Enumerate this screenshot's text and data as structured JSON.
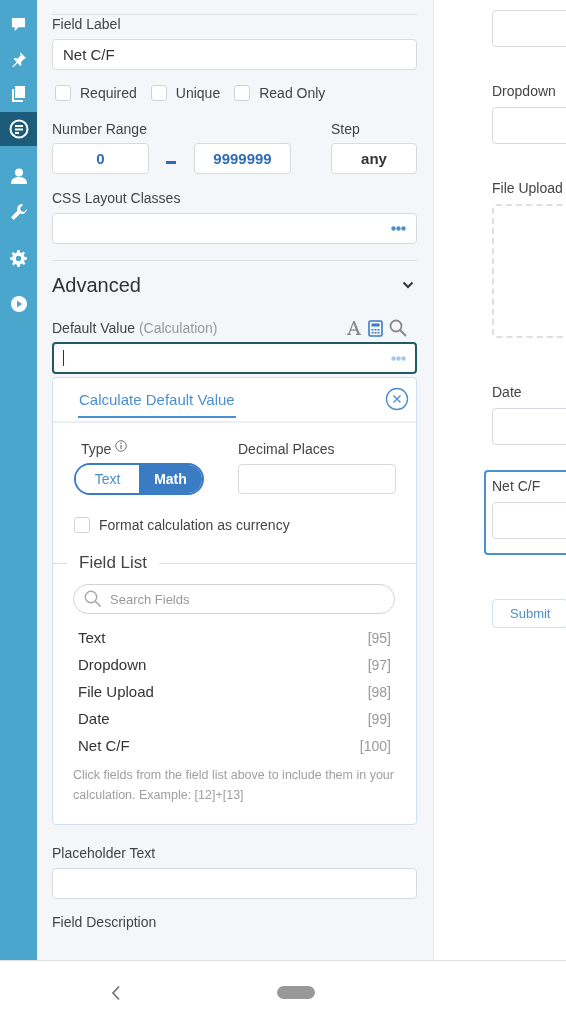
{
  "sidebar": {
    "items": [
      {
        "kind": "chat",
        "selected": false
      },
      {
        "kind": "pin",
        "selected": false
      },
      {
        "kind": "pages",
        "selected": false
      },
      {
        "kind": "form",
        "selected": true
      },
      {
        "kind": "user",
        "selected": false
      },
      {
        "kind": "wrench",
        "selected": false
      },
      {
        "kind": "gear",
        "selected": false
      },
      {
        "kind": "play",
        "selected": false
      }
    ]
  },
  "field_settings": {
    "field_label": {
      "label": "Field Label",
      "value": "Net C/F"
    },
    "options": [
      {
        "label": "Required",
        "checked": false
      },
      {
        "label": "Unique",
        "checked": false
      },
      {
        "label": "Read Only",
        "checked": false
      }
    ],
    "number_range": {
      "label": "Number Range",
      "min": "0",
      "max": "9999999"
    },
    "step": {
      "label": "Step",
      "value": "any"
    },
    "css_classes": {
      "label": "CSS Layout Classes"
    }
  },
  "advanced": {
    "title": "Advanced",
    "expanded": true,
    "default_value": {
      "label": "Default Value",
      "note": "(Calculation)"
    },
    "calc_popup": {
      "tab": "Calculate Default Value",
      "type_label": "Type",
      "type_options": [
        {
          "label": "Text",
          "selected": false
        },
        {
          "label": "Math",
          "selected": true
        }
      ],
      "decimal_places_label": "Decimal Places",
      "currency": {
        "label": "Format calculation as currency",
        "checked": false
      },
      "field_list_title": "Field List",
      "search_placeholder": "Search Fields",
      "fields": [
        {
          "name": "Text",
          "ref": "[95]"
        },
        {
          "name": "Dropdown",
          "ref": "[97]"
        },
        {
          "name": "File Upload",
          "ref": "[98]"
        },
        {
          "name": "Date",
          "ref": "[99]"
        },
        {
          "name": "Net C/F",
          "ref": "[100]"
        }
      ],
      "help": "Click fields from the field list above to include them in your calculation. Example: [12]+[13]"
    },
    "placeholder_text": {
      "label": "Placeholder Text"
    },
    "field_description": {
      "label": "Field Description"
    }
  },
  "preview": {
    "fields": [
      {
        "kind": "input",
        "selected": false
      },
      {
        "kind": "input",
        "label": "Dropdown",
        "selected": false
      },
      {
        "kind": "upload",
        "label": "File Upload",
        "selected": false
      },
      {
        "kind": "input",
        "label": "Date",
        "selected": false
      },
      {
        "kind": "input",
        "label": "Net C/F",
        "selected": true
      }
    ],
    "submit": "Submit"
  }
}
